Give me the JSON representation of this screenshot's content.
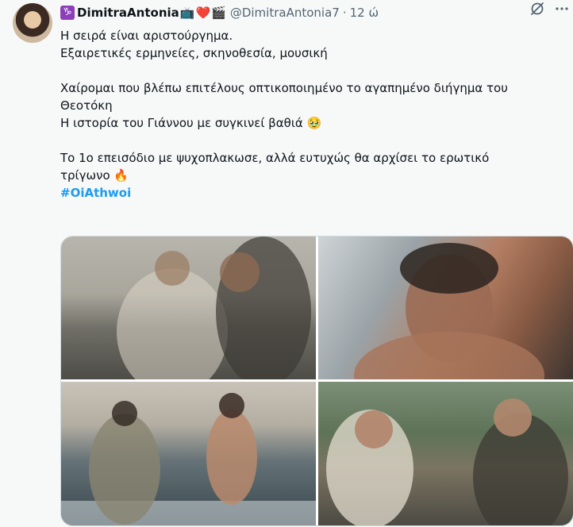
{
  "tweet": {
    "zodiac_symbol": "♑",
    "display_name": "DimitraAntonia",
    "name_emojis": [
      "📺",
      "❤️",
      "🎬"
    ],
    "handle": "@DimitraAntonia7",
    "separator": "·",
    "time": "12 ώ",
    "text_lines": [
      "Η σειρά είναι αριστούργημα.",
      "Εξαιρετικές ερμηνείες, σκηνοθεσία, μουσική",
      "",
      "Χαίρομαι που βλέπω επιτέλους οπτικοποιημένο το αγαπημένο διήγημα του",
      "Θεοτόκη",
      "Η ιστορία του Γιάννου με συγκινεί βαθιά 🥹",
      "",
      "Το 1ο επεισόδιο με ψυχοπλακωσε, αλλά ευτυχώς θα αρχίσει το ερωτικό",
      "τρίγωνο 🔥"
    ],
    "hashtag": "#OiAthwoi"
  },
  "icons": {
    "grok": "grok-icon",
    "more": "more-icon"
  },
  "colors": {
    "link": "#1d9bf0",
    "muted": "#536471",
    "border": "#cfd9de",
    "background": "#f7f9f9"
  }
}
